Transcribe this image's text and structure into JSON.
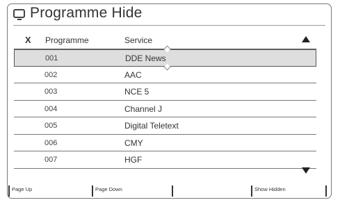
{
  "window": {
    "title": "Programme Hide",
    "icon": "tv-icon"
  },
  "table": {
    "headers": {
      "hide": "X",
      "programme": "Programme",
      "service": "Service"
    },
    "rows": [
      {
        "programme": "001",
        "service": "DDE News",
        "selected": true
      },
      {
        "programme": "002",
        "service": "AAC"
      },
      {
        "programme": "003",
        "service": "NCE 5"
      },
      {
        "programme": "004",
        "service": "Channel J"
      },
      {
        "programme": "005",
        "service": "Digital Teletext"
      },
      {
        "programme": "006",
        "service": "CMY"
      },
      {
        "programme": "007",
        "service": "HGF"
      }
    ]
  },
  "function_keys": [
    {
      "label": "Page Up"
    },
    {
      "label": "Page Down"
    },
    {
      "label": ""
    },
    {
      "label": "Show Hidden"
    }
  ]
}
